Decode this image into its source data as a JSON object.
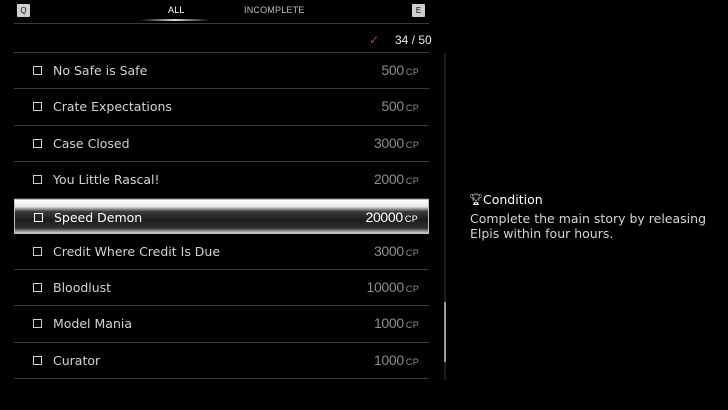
{
  "header": {
    "key_left": "Q",
    "key_right": "E",
    "tabs": [
      {
        "label": "ALL",
        "active": true
      },
      {
        "label": "INCOMPLETE",
        "active": false
      }
    ]
  },
  "progress": {
    "check_icon": "checkmark-icon",
    "completed": 34,
    "total": 50,
    "label": "34 / 50"
  },
  "challenges": [
    {
      "title": "No Safe is Safe",
      "points": "500",
      "unit": "CP",
      "completed": false
    },
    {
      "title": "Crate Expectations",
      "points": "500",
      "unit": "CP",
      "completed": false
    },
    {
      "title": "Case Closed",
      "points": "3000",
      "unit": "CP",
      "completed": false
    },
    {
      "title": "You Little Rascal!",
      "points": "2000",
      "unit": "CP",
      "completed": false
    },
    {
      "title": "Speed Demon",
      "points": "20000",
      "unit": "CP",
      "completed": false,
      "selected": true
    },
    {
      "title": "Credit Where Credit Is Due",
      "points": "3000",
      "unit": "CP",
      "completed": false
    },
    {
      "title": "Bloodlust",
      "points": "10000",
      "unit": "CP",
      "completed": false
    },
    {
      "title": "Model Mania",
      "points": "1000",
      "unit": "CP",
      "completed": false
    },
    {
      "title": "Curator",
      "points": "1000",
      "unit": "CP",
      "completed": false
    }
  ],
  "detail": {
    "icon": "trophy-icon",
    "heading": "Condition",
    "text": "Complete the main story by releasing Elpis within four hours."
  },
  "colors": {
    "background": "#000000",
    "check_accent": "#c0393b",
    "selected_row": "#ffffff"
  }
}
